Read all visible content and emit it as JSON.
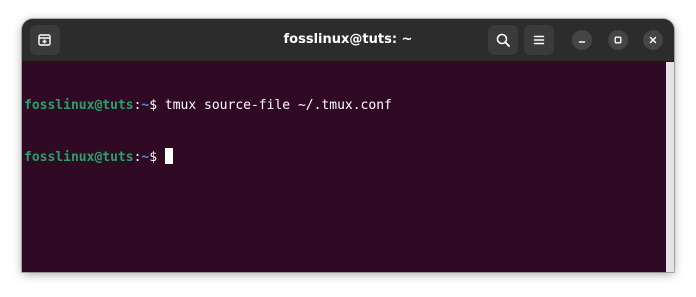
{
  "window": {
    "title": "fosslinux@tuts: ~"
  },
  "header": {
    "new_tab_icon": "new-tab-icon",
    "search_icon": "search-icon",
    "menu_icon": "hamburger-menu-icon",
    "minimize_icon": "minimize-icon",
    "maximize_icon": "maximize-icon",
    "close_icon": "close-icon"
  },
  "terminal": {
    "lines": [
      {
        "user": "fosslinux@tuts",
        "colon": ":",
        "path": "~",
        "symbol": "$ ",
        "command": "tmux source-file ~/.tmux.conf"
      },
      {
        "user": "fosslinux@tuts",
        "colon": ":",
        "path": "~",
        "symbol": "$ ",
        "command": ""
      }
    ]
  },
  "colors": {
    "background": "#300a24",
    "titlebar": "#2c2c2c",
    "prompt_user": "#26a269",
    "prompt_path": "#5a8fd6",
    "text": "#ffffff"
  }
}
